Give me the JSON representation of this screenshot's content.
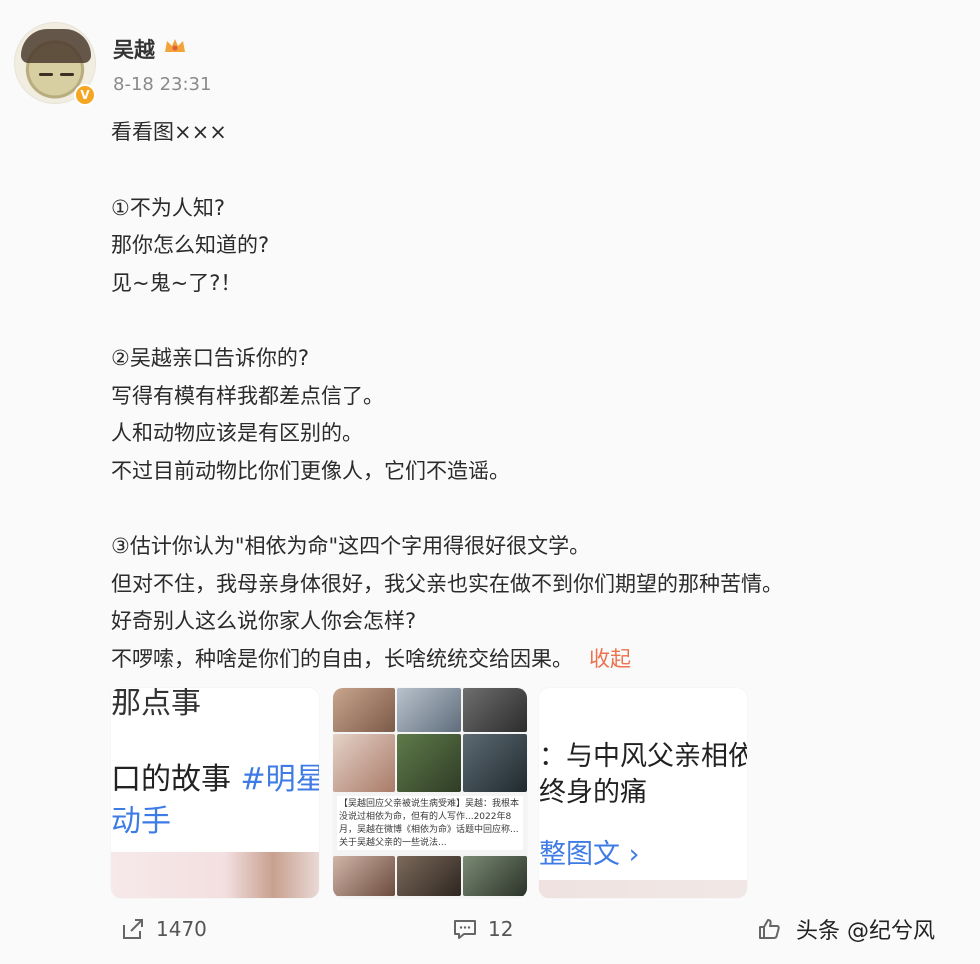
{
  "post": {
    "author": "吴越",
    "timestamp": "8-18 23:31",
    "lines": [
      "看看图×××",
      "",
      "①不为人知?",
      "那你怎么知道的?",
      "见~鬼~了?！",
      "",
      "②吴越亲口告诉你的?",
      "写得有模有样我都差点信了。",
      "人和动物应该是有区别的。",
      "不过目前动物比你们更像人，它们不造谣。",
      "",
      "③估计你认为\"相依为命\"这四个字用得很好很文学。",
      "但对不住，我母亲身体很好，我父亲也实在做不到你们期望的那种苦情。",
      "好奇别人这么说你家人你会怎样?"
    ],
    "last_line": "不啰嗦，种啥是你们的自由，长啥统统交给因果。",
    "collapse_label": "收起"
  },
  "cards": {
    "card1": {
      "top_text": "那点事",
      "line1_text": "的故事",
      "line1_prefix": "口",
      "line1_tag": "#明星",
      "line2_text": "动手"
    },
    "card2": {
      "caption": "【吴越回应父亲被说生病受难】吴越：我根本没说过相依为命，但有的人写作...2022年8月，吴越在微博《相依为命》话题中回应称...关于吴越父亲的一些说法..."
    },
    "card3": {
      "line1": "：与中风父亲相依",
      "line2": "终身的痛",
      "line3": "整图文 ›"
    }
  },
  "actions": {
    "share_count": "1470",
    "comment_count": "12",
    "like_label": ""
  },
  "watermark": "头条 @纪兮风",
  "colors": {
    "accent_orange": "#eb7350",
    "link_blue": "#3e7be4",
    "verify_gold": "#f5a623"
  }
}
